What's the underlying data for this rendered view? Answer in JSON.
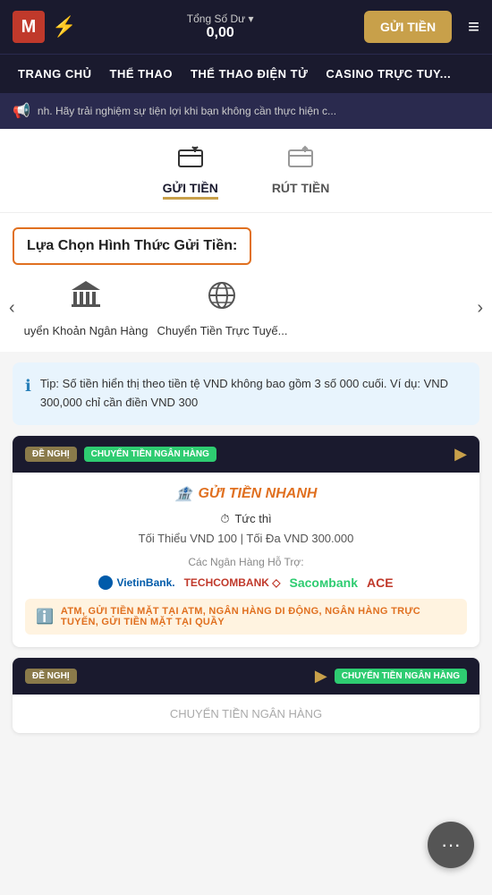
{
  "header": {
    "logo_m": "M",
    "logo_flash": "⚡",
    "balance_label": "Tổng Số Dư ▾",
    "balance_amount": "0,00",
    "deposit_btn": "GỬI TIỀN",
    "hamburger": "≡"
  },
  "nav": {
    "items": [
      {
        "label": "TRANG CHỦ"
      },
      {
        "label": "THỂ THAO"
      },
      {
        "label": "THỂ THAO ĐIỆN TỬ"
      },
      {
        "label": "CASINO TRỰC TUY..."
      }
    ]
  },
  "banner": {
    "icon": "📢",
    "text": "nh. Hãy trải nghiệm sự tiện lợi khi bạn không cần thực hiện c..."
  },
  "tabs": [
    {
      "id": "gui-tien",
      "label": "GỬI TIỀN",
      "icon": "💳",
      "active": true
    },
    {
      "id": "rut-tien",
      "label": "RÚT TIỀN",
      "icon": "💰",
      "active": false
    }
  ],
  "section": {
    "label": "Lựa Chọn Hình Thức Gửi Tiền:"
  },
  "carousel": {
    "left_arrow": "‹",
    "right_arrow": "›",
    "items": [
      {
        "icon": "🏛",
        "label": "uyển Khoản Ngân Hàng"
      },
      {
        "icon": "🌐",
        "label": "Chuyển Tiền Trực Tuyế..."
      }
    ]
  },
  "tip": {
    "icon": "ℹ",
    "text": "Tip: Số tiền hiển thị theo tiền tệ VND không bao gồm 3 số 000 cuối. Ví dụ: VND 300,000 chỉ cần điền VND 300"
  },
  "payment_card_1": {
    "badge_recommended": "ĐỀ NGHỊ",
    "badge_transfer": "CHUYỂN TIỀN NGÂN HÀNG",
    "corner_icon": "▶",
    "title_icon": "🏦",
    "title": "GỬI TIỀN NHANH",
    "speed_icon": "⏱",
    "speed_label": "Tức thì",
    "min_label": "Tối Thiểu VND 100",
    "separator": "|",
    "max_label": "Tối Đa VND 300.000",
    "banks_label": "Các Ngân Hàng Hỗ Trợ:",
    "banks": [
      {
        "name": "VietinBank.",
        "class": "vietinbank"
      },
      {
        "name": "TECHCOMBANK ◇",
        "class": "techcom"
      },
      {
        "name": "Sacoмbank",
        "class": "sacom"
      },
      {
        "name": "ACE",
        "class": "ace"
      }
    ],
    "atm_icon": "ℹ",
    "atm_text": "ATM, GỬI TIỀN MẶT TẠI ATM, NGÂN HÀNG DI ĐỘNG, NGÂN HÀNG TRỰC TUYẾN, GỬI TIỀN MẶT TẠI QUẦY"
  },
  "payment_card_2": {
    "badge_recommended": "ĐỀ NGHỊ",
    "badge_icon": "▶",
    "badge_transfer": "CHUYỂN TIỀN NGÂN HÀNG"
  },
  "chat": {
    "icon": "···"
  }
}
